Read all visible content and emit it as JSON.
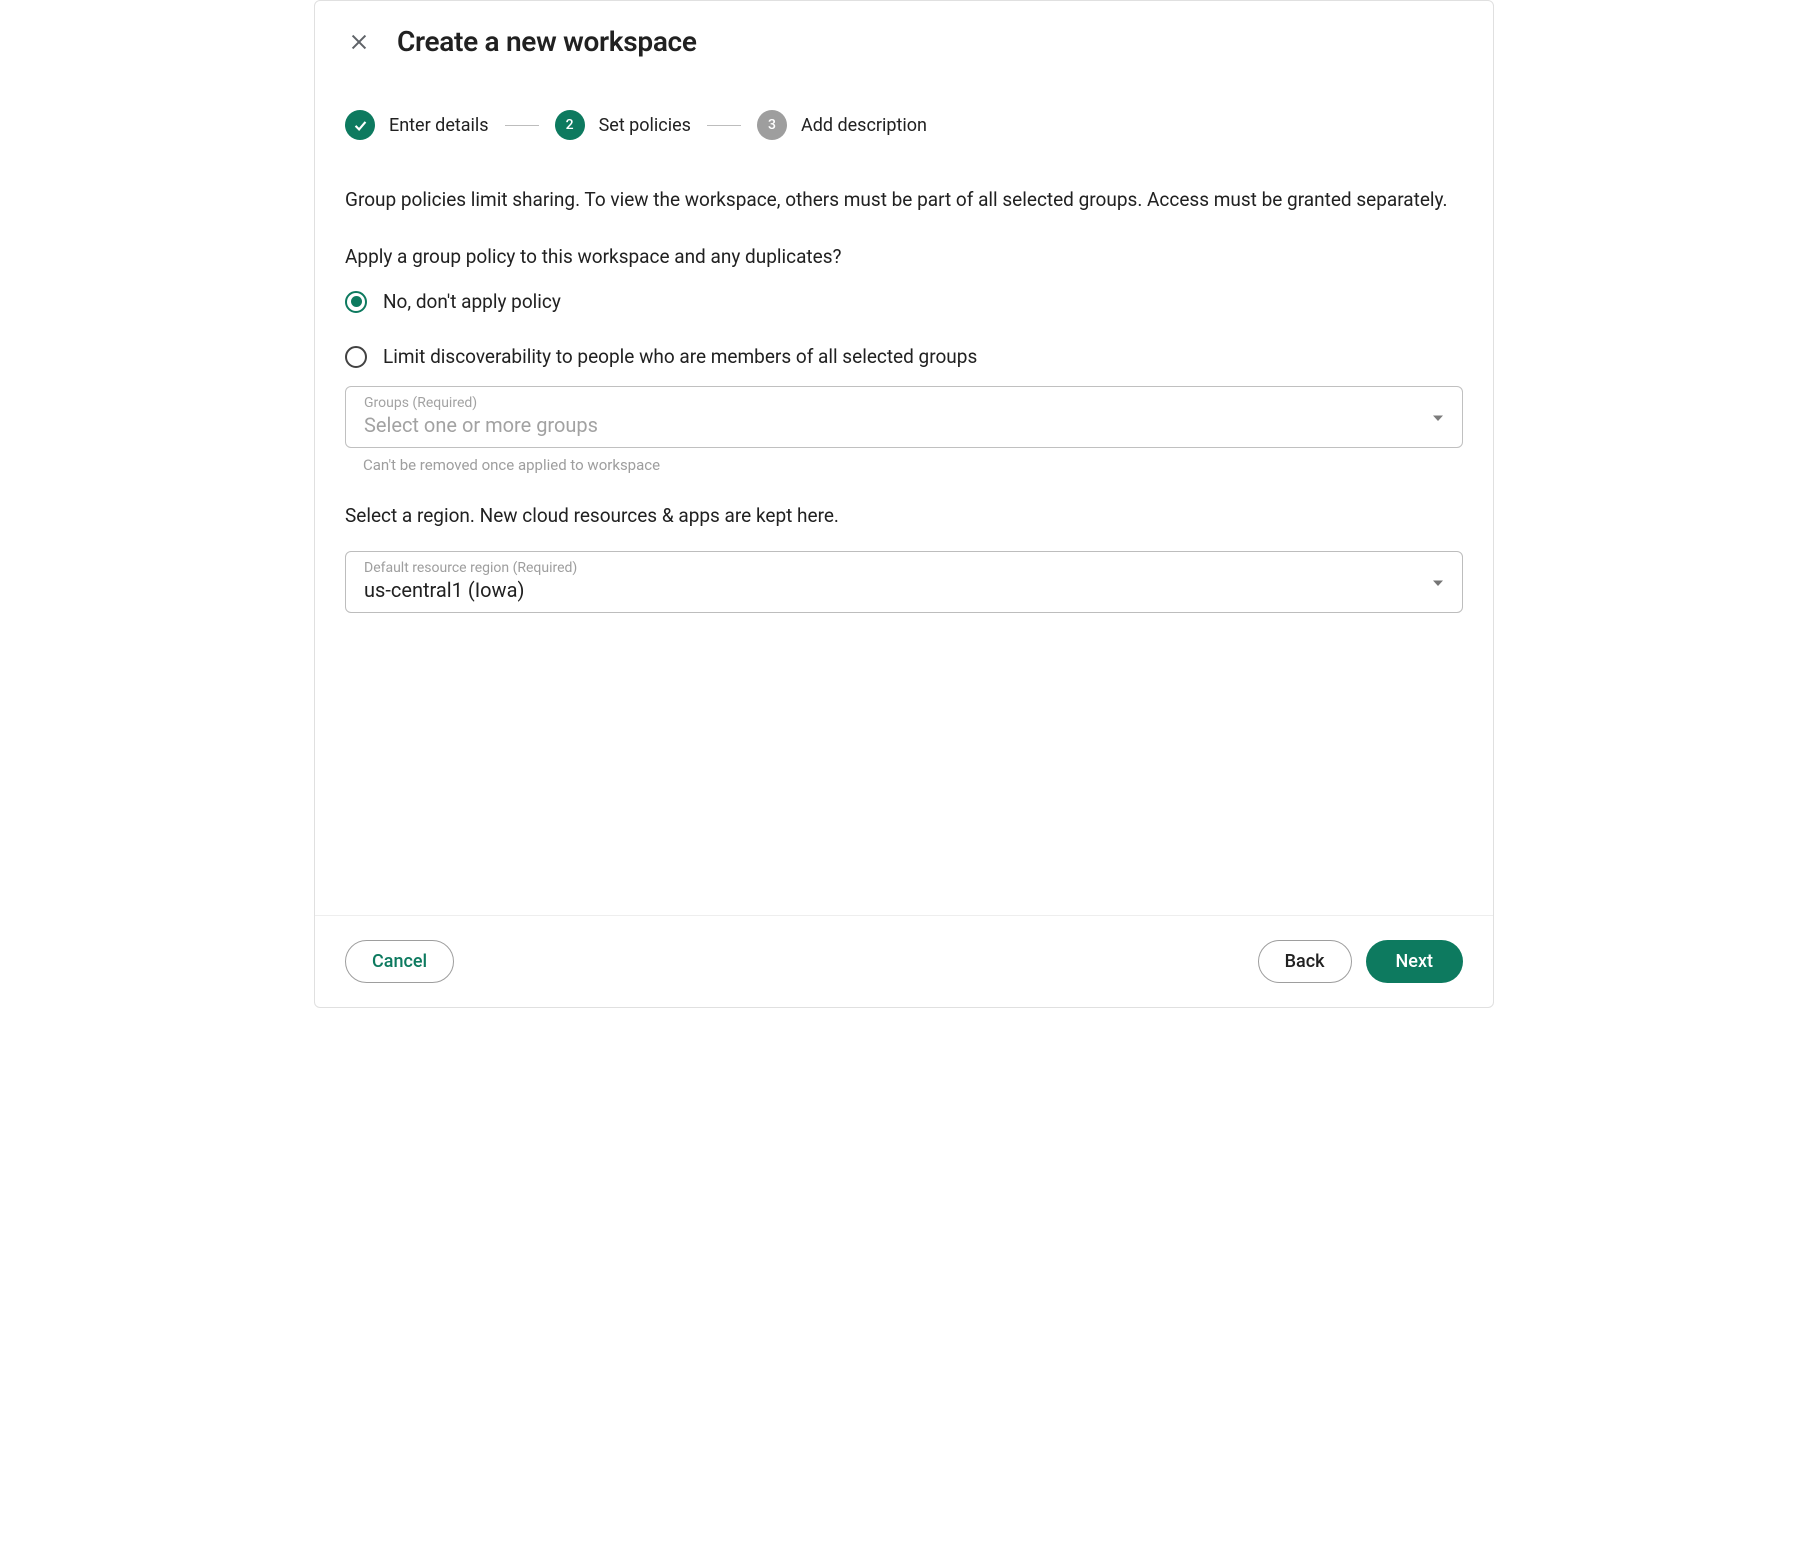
{
  "header": {
    "title": "Create a new workspace"
  },
  "stepper": {
    "steps": [
      {
        "label": "Enter details",
        "state": "done"
      },
      {
        "label": "Set policies",
        "number": "2",
        "state": "active"
      },
      {
        "label": "Add description",
        "number": "3",
        "state": "inactive"
      }
    ]
  },
  "body": {
    "intro": "Group policies limit sharing. To view the workspace, others must be part of all selected groups. Access must be granted separately.",
    "policy_question": "Apply a group policy to this workspace and any duplicates?",
    "radio_options": {
      "no_policy": "No, don't apply policy",
      "limit": "Limit discoverability to people who are members of all selected groups"
    },
    "radio_selected": "no_policy",
    "groups_field": {
      "label": "Groups (Required)",
      "placeholder": "Select one or more groups",
      "helper": "Can't be removed once applied to workspace"
    },
    "region_label": "Select a region. New cloud resources & apps are kept here.",
    "region_field": {
      "label": "Default resource region (Required)",
      "value": "us-central1 (Iowa)"
    }
  },
  "footer": {
    "cancel": "Cancel",
    "back": "Back",
    "next": "Next"
  },
  "colors": {
    "primary": "#0d7a5f",
    "inactive": "#9e9e9e"
  }
}
